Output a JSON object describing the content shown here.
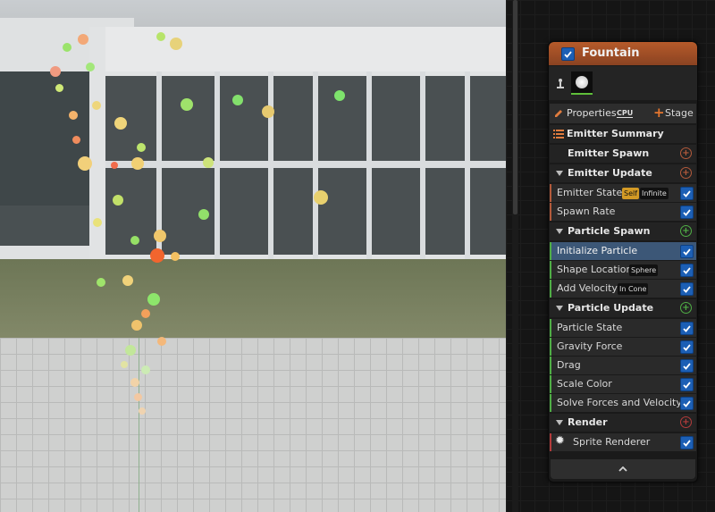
{
  "node": {
    "title": "Fountain",
    "properties_label": "Properties",
    "cpu_badge": "CPU",
    "stage_label": "Stage",
    "emitter_summary": "Emitter Summary",
    "emitter_spawn": "Emitter Spawn",
    "emitter_update": "Emitter Update",
    "emitter_state": "Emitter State",
    "emitter_state_tag1": "Self",
    "emitter_state_tag2": "Infinite",
    "spawn_rate": "Spawn Rate",
    "particle_spawn": "Particle Spawn",
    "initialize_particle": "Initialize Particle",
    "shape_location": "Shape Location",
    "shape_location_tag": "Sphere",
    "add_velocity": "Add Velocity",
    "add_velocity_tag": "In Cone",
    "particle_update": "Particle Update",
    "particle_state": "Particle State",
    "gravity_force": "Gravity Force",
    "drag": "Drag",
    "scale_color": "Scale Color",
    "solve_forces": "Solve Forces and Velocity",
    "render": "Render",
    "sprite_renderer": "Sprite Renderer"
  },
  "icons": {
    "plus_symbol": "+",
    "collapse_symbol": "⌃",
    "sprite_icon": "✹"
  },
  "colors": {
    "header": "#b65a2a",
    "spawn_accent": "#b35a3b",
    "particle_spawn_accent": "#4fae45",
    "particle_update_accent": "#4fae45",
    "render_accent": "#b33b3b",
    "selected_row": "#3c5777",
    "checkbox": "#1c5fb5"
  }
}
